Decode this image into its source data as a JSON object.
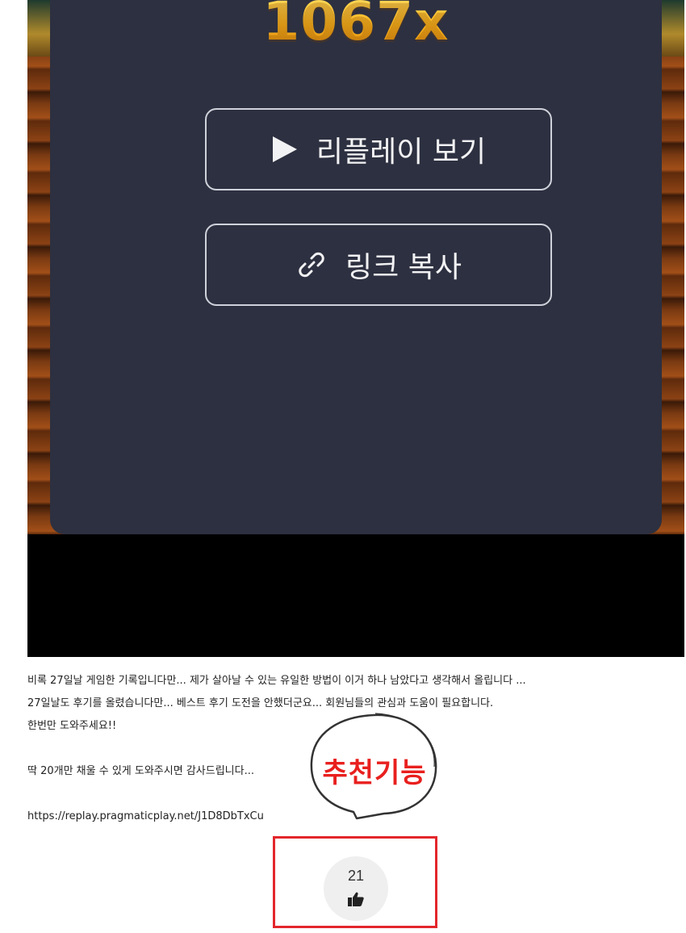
{
  "game": {
    "multiplier": "1067x",
    "replay_label": "리플레이 보기",
    "copy_link_label": "링크 복사",
    "icons": [
      "play-icon",
      "link-icon"
    ]
  },
  "post": {
    "line1": "비록 27일날 게임한 기록입니다만... 제가 살아날 수 있는 유일한 방법이 이거 하나 남았다고 생각해서 올립니다 ...",
    "line2": "27일날도 후기를 올렸습니다만... 베스트 후기 도전을 안했더군요... 회원님들의 관심과 도움이 필요합니다.",
    "line3": "한번만 도와주세요!!",
    "line4": "딱 20개만 채울 수 있게 도와주시면 감사드립니다...",
    "url": "https://replay.pragmaticplay.net/J1D8DbTxCu"
  },
  "callout": {
    "text": "추천기능",
    "color": "#e8201e"
  },
  "like": {
    "count": "21",
    "icon": "thumbs-up-icon"
  },
  "colors": {
    "panel": "#2d3040",
    "highlight": "#e3262b",
    "gold": "#f6b21c"
  }
}
